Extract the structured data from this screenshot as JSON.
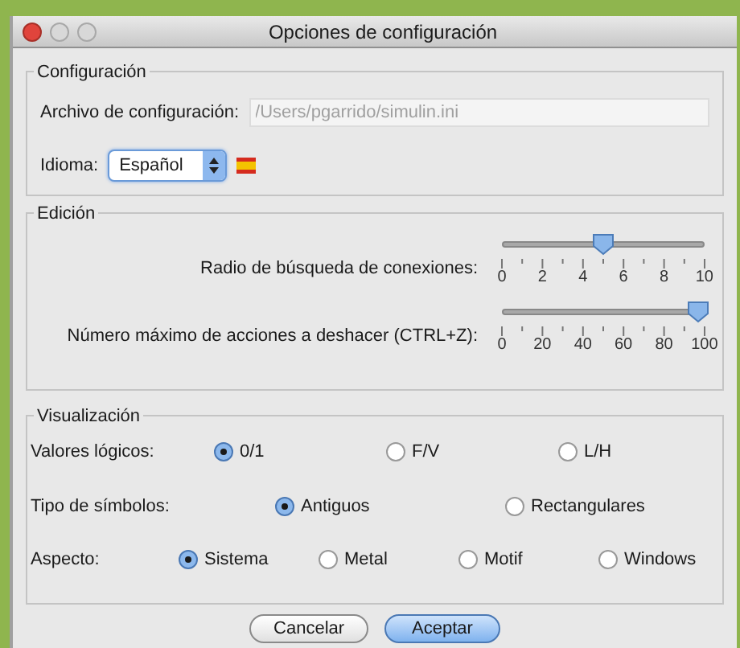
{
  "window": {
    "title": "Opciones de configuración"
  },
  "configuracion": {
    "title": "Configuración",
    "file_label": "Archivo de configuración:",
    "file_value": "/Users/pgarrido/simulin.ini",
    "language_label": "Idioma:",
    "language_value": "Español"
  },
  "edicion": {
    "title": "Edición",
    "sliders": [
      {
        "label": "Radio de búsqueda de conexiones:",
        "level": 0.5,
        "ticks": [
          "0",
          "2",
          "4",
          "6",
          "8",
          "10"
        ]
      },
      {
        "label": "Número máximo de acciones a deshacer (CTRL+Z):",
        "level": 1.0,
        "ticks": [
          "0",
          "20",
          "40",
          "60",
          "80",
          "100"
        ]
      }
    ]
  },
  "visualizacion": {
    "title": "Visualización",
    "groups": [
      {
        "label": "Valores lógicos:",
        "options": [
          {
            "label": "0/1",
            "selected": true
          },
          {
            "label": "F/V",
            "selected": false
          },
          {
            "label": "L/H",
            "selected": false
          }
        ]
      },
      {
        "label": "Tipo de símbolos:",
        "options": [
          {
            "label": "Antiguos",
            "selected": true
          },
          {
            "label": "Rectangulares",
            "selected": false
          }
        ]
      },
      {
        "label": "Aspecto:",
        "options": [
          {
            "label": "Sistema",
            "selected": true
          },
          {
            "label": "Metal",
            "selected": false
          },
          {
            "label": "Motif",
            "selected": false
          },
          {
            "label": "Windows",
            "selected": false
          }
        ]
      }
    ]
  },
  "buttons": [
    {
      "label": "Cancelar",
      "default": false
    },
    {
      "label": "Aceptar",
      "default": true
    }
  ]
}
